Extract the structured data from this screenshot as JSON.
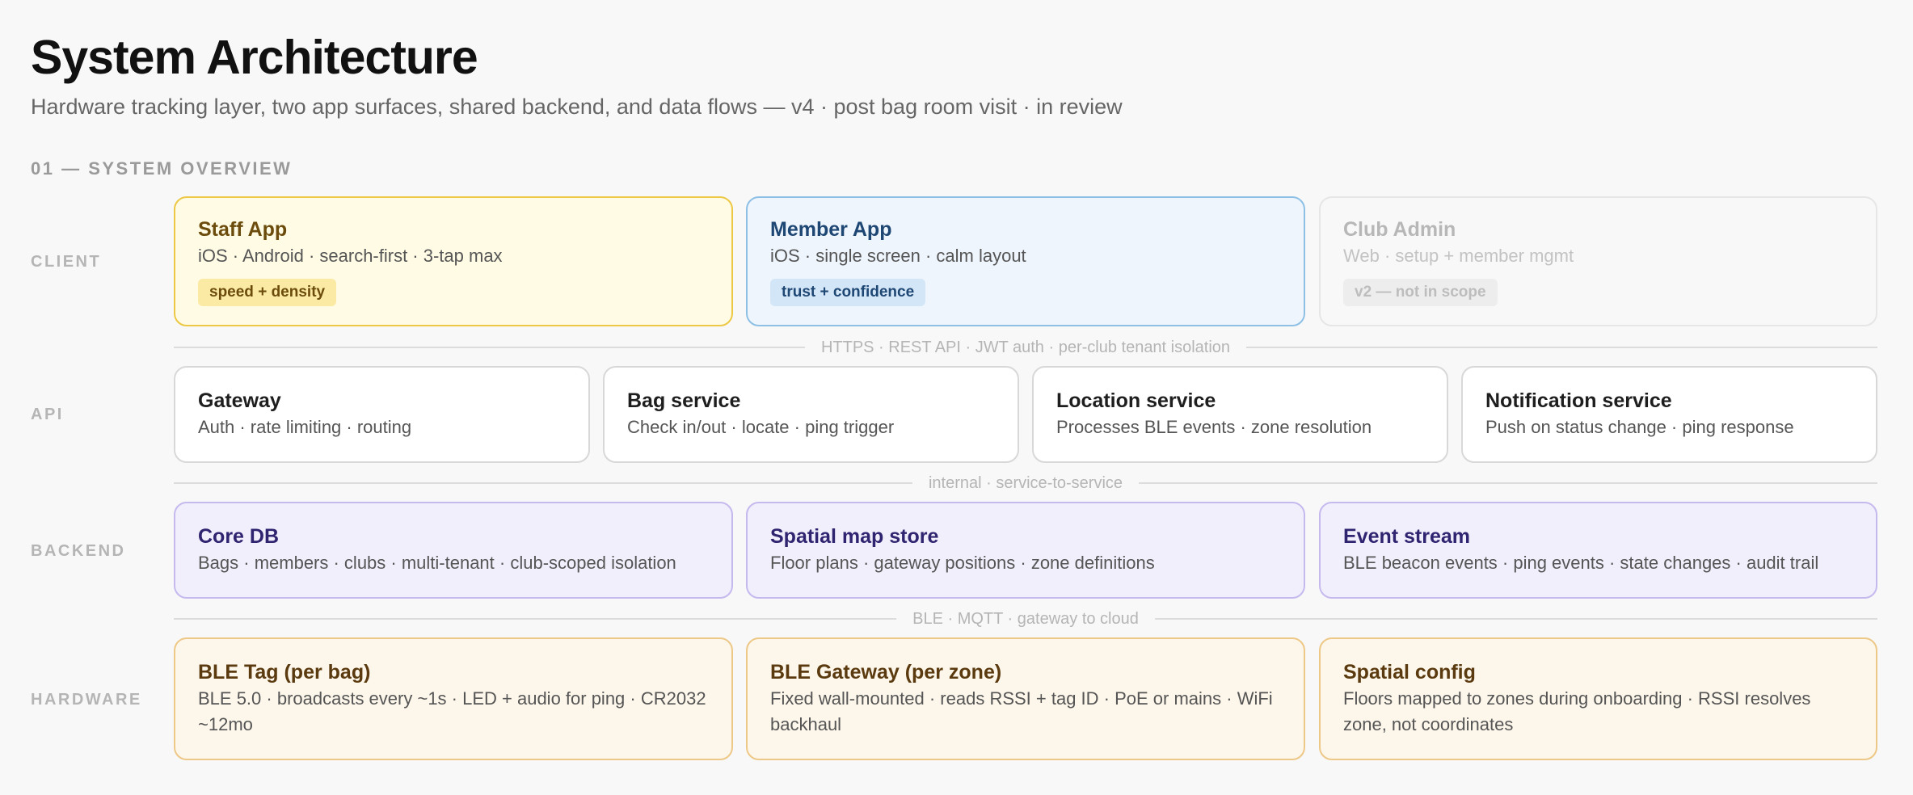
{
  "header": {
    "title": "System Architecture",
    "subtitle": "Hardware tracking layer, two app surfaces, shared backend, and data flows — v4 · post bag room visit · in review"
  },
  "section": {
    "label": "01 — SYSTEM OVERVIEW"
  },
  "layers": {
    "client": "CLIENT",
    "api": "API",
    "backend": "BACKEND",
    "hardware": "HARDWARE"
  },
  "client": {
    "staff": {
      "title": "Staff App",
      "desc": "iOS · Android · search-first · 3-tap max",
      "tag": "speed + density"
    },
    "member": {
      "title": "Member App",
      "desc": "iOS · single screen · calm layout",
      "tag": "trust + confidence"
    },
    "admin": {
      "title": "Club Admin",
      "desc": "Web · setup + member mgmt",
      "tag": "v2 — not in scope"
    }
  },
  "connectors": {
    "client_api": "HTTPS · REST API · JWT auth · per-club tenant isolation",
    "api_backend": "internal · service-to-service",
    "backend_hardware": "BLE · MQTT · gateway to cloud"
  },
  "api": {
    "gateway": {
      "title": "Gateway",
      "desc": "Auth · rate limiting · routing"
    },
    "bag": {
      "title": "Bag service",
      "desc": "Check in/out · locate · ping trigger"
    },
    "location": {
      "title": "Location service",
      "desc": "Processes BLE events · zone resolution"
    },
    "notification": {
      "title": "Notification service",
      "desc": "Push on status change · ping response"
    }
  },
  "backend": {
    "coredb": {
      "title": "Core DB",
      "desc": "Bags · members · clubs · multi-tenant · club-scoped isolation"
    },
    "spatial": {
      "title": "Spatial map store",
      "desc": "Floor plans · gateway positions · zone definitions"
    },
    "events": {
      "title": "Event stream",
      "desc": "BLE beacon events · ping events · state changes · audit trail"
    }
  },
  "hardware": {
    "tag": {
      "title": "BLE Tag (per bag)",
      "desc": "BLE 5.0 · broadcasts every ~1s · LED + audio for ping · CR2032 ~12mo"
    },
    "gateway": {
      "title": "BLE Gateway (per zone)",
      "desc": "Fixed wall-mounted · reads RSSI + tag ID · PoE or mains · WiFi backhaul"
    },
    "config": {
      "title": "Spatial config",
      "desc": "Floors mapped to zones during onboarding · RSSI resolves zone, not coordinates"
    }
  }
}
